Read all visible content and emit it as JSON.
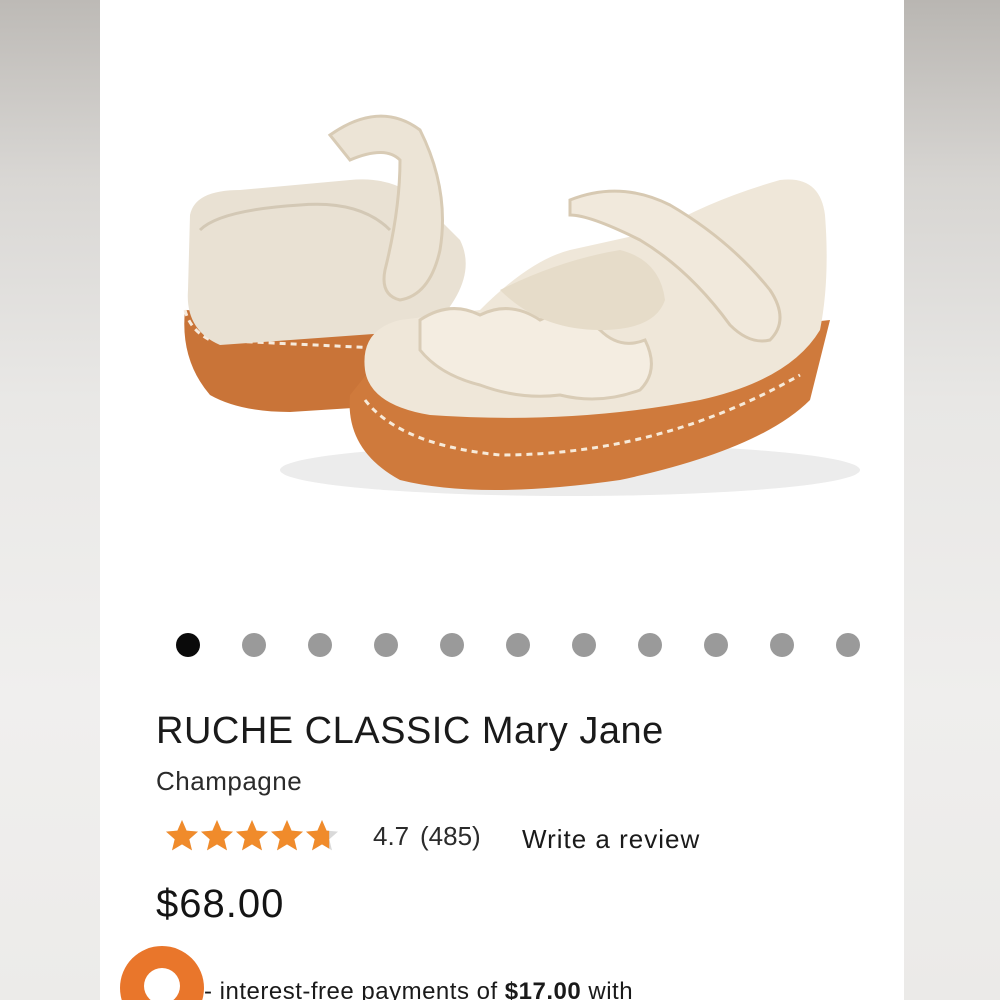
{
  "product": {
    "title": "RUCHE CLASSIC Mary Jane",
    "color": "Champagne",
    "price": "$68.00"
  },
  "gallery": {
    "total_images": 11,
    "active_index": 0,
    "image_icon": "product-photo-shoes"
  },
  "rating": {
    "value": "4.7",
    "count": "(485)",
    "stars_filled_fraction": 0.94,
    "write_review_label": "Write a review",
    "star_color": "#f08b2b"
  },
  "installments": {
    "prefix": "interest-free payments of ",
    "amount": "$17.00",
    "suffix": " with",
    "brand_color": "#e9762b"
  }
}
